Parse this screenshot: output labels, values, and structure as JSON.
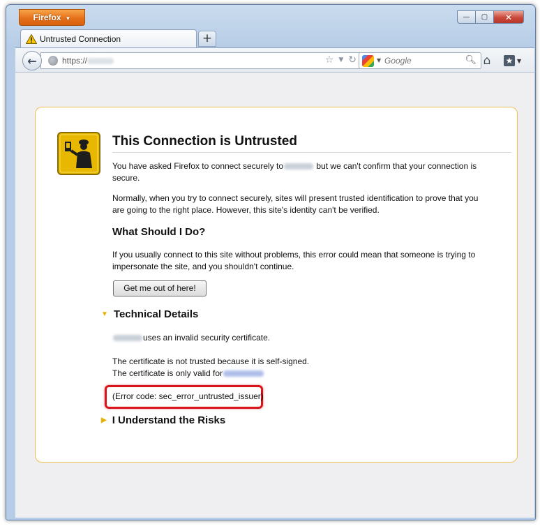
{
  "window": {
    "app_button": "Firefox",
    "controls": {
      "minimize": "▭",
      "maximize": "▢",
      "close": "✕"
    }
  },
  "tabs": [
    {
      "label": "Untrusted Connection",
      "icon": "warning-icon",
      "active": true
    }
  ],
  "new_tab_label": "+",
  "navbar": {
    "url_prefix": "https://",
    "search_placeholder": "Google",
    "search_engine_icon": "google-icon"
  },
  "error_page": {
    "title": "This Connection is Untrusted",
    "para1_a": "You have asked Firefox to connect securely to",
    "para1_b": "but we can't confirm that your connection is secure.",
    "para2": "Normally, when you try to connect securely, sites will present trusted identification to prove that you are going to the right place. However, this site's identity can't be verified.",
    "what_heading": "What Should I Do?",
    "para3": "If you usually connect to this site without problems, this error could mean that someone is trying to impersonate the site, and you shouldn't continue.",
    "get_out_button": "Get me out of here!",
    "technical_heading": "Technical Details",
    "tech_line1": "uses an invalid security certificate.",
    "tech_line2": "The certificate is not trusted because it is self-signed.",
    "tech_line3": "The certificate is only valid for",
    "error_code": "(Error code: sec_error_untrusted_issuer)",
    "risks_heading": "I Understand the Risks"
  },
  "colors": {
    "box_border": "#f0c04a",
    "highlight": "#d9141b",
    "firefox_orange": "#e5711a"
  }
}
